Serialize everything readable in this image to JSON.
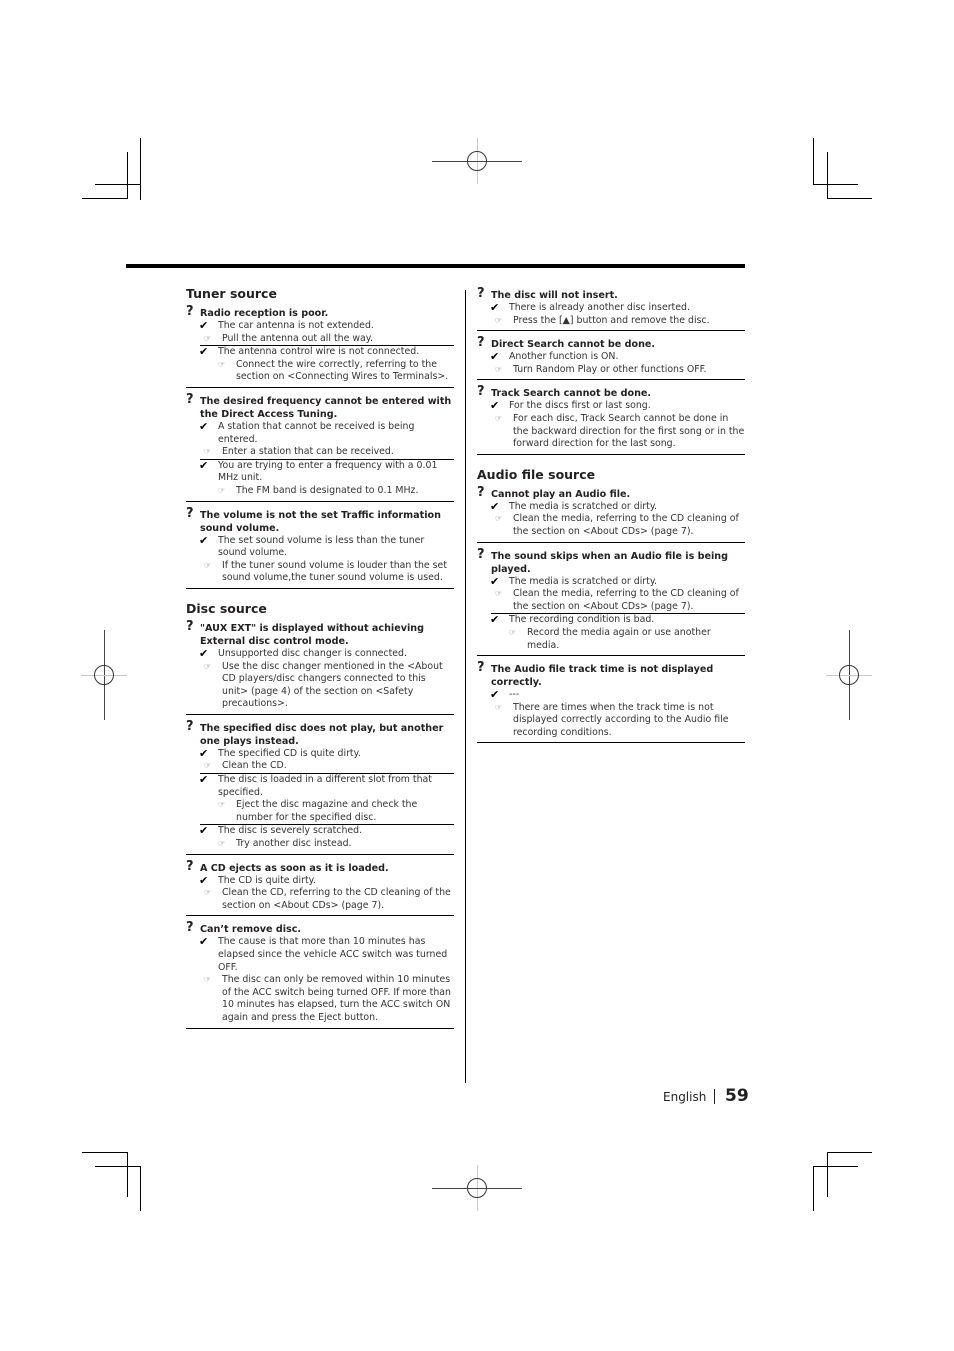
{
  "sections_left": [
    {
      "title": "Tuner source",
      "problems": [
        {
          "question": "Radio reception is poor.",
          "causes": [
            {
              "cause": "The car antenna is not extended.",
              "fix": "Pull the antenna out all the way."
            },
            {
              "cause": "The antenna control wire is not connected.",
              "fix": "Connect the wire correctly, referring to the section on <Connecting Wires to Terminals>."
            }
          ]
        },
        {
          "question": "The desired frequency cannot be entered with the Direct Access Tuning.",
          "causes": [
            {
              "cause": "A station that cannot be received is being entered.",
              "fix": "Enter a station that can be received."
            },
            {
              "cause": "You are trying to enter a frequency with a 0.01 MHz unit.",
              "fix": "The FM band is designated to 0.1 MHz."
            }
          ]
        },
        {
          "question": "The volume is not the set Traffic information sound volume.",
          "causes": [
            {
              "cause": "The set sound volume is less than the tuner sound volume.",
              "fix": "If the tuner sound volume is louder than the set sound volume,the tuner sound volume is used."
            }
          ]
        }
      ]
    },
    {
      "title": "Disc source",
      "problems": [
        {
          "question": "\"AUX EXT\" is displayed without achieving External disc control mode.",
          "causes": [
            {
              "cause": "Unsupported disc changer is connected.",
              "fix": "Use the disc changer mentioned in the <About CD players/disc changers connected to this unit> (page 4) of the section on <Safety precautions>."
            }
          ]
        },
        {
          "question": "The specified disc does not play, but another one plays instead.",
          "causes": [
            {
              "cause": "The specified CD is quite dirty.",
              "fix": "Clean the CD."
            },
            {
              "cause": "The disc is loaded in a different slot from that specified.",
              "fix": "Eject the disc magazine and check the number for the specified disc."
            },
            {
              "cause": "The disc is severely scratched.",
              "fix": "Try another disc instead."
            }
          ]
        },
        {
          "question": "A CD ejects as soon as it is loaded.",
          "causes": [
            {
              "cause": "The CD is quite dirty.",
              "fix": "Clean the CD, referring to the CD cleaning of the section on <About CDs> (page 7)."
            }
          ]
        },
        {
          "question": "Can’t remove disc.",
          "causes": [
            {
              "cause": "The cause is that more than 10 minutes has elapsed since the vehicle ACC switch was turned OFF.",
              "fix": "The disc can only be removed within 10 minutes of the ACC switch being turned OFF. If more than 10 minutes has elapsed, turn the ACC switch ON again and press the Eject button."
            }
          ]
        }
      ]
    }
  ],
  "sections_right": [
    {
      "title": "",
      "problems": [
        {
          "question": "The disc will not insert.",
          "causes": [
            {
              "cause": "There is already another disc inserted.",
              "fix": "Press the [▲] button and remove the disc."
            }
          ]
        },
        {
          "question": "Direct Search cannot be done.",
          "causes": [
            {
              "cause": "Another function is ON.",
              "fix": "Turn Random Play or other functions OFF."
            }
          ]
        },
        {
          "question": "Track Search cannot be done.",
          "causes": [
            {
              "cause": "For the discs first or last song.",
              "fix": "For each disc, Track Search cannot be done in the backward direction for the first song or in the forward direction for the last song."
            }
          ]
        }
      ]
    },
    {
      "title": "Audio file source",
      "problems": [
        {
          "question": "Cannot play an Audio file.",
          "causes": [
            {
              "cause": "The media is scratched or dirty.",
              "fix": "Clean the media, referring to the CD cleaning of the section on <About CDs> (page 7)."
            }
          ]
        },
        {
          "question": "The sound skips when an Audio file is being played.",
          "causes": [
            {
              "cause": "The media is scratched or dirty.",
              "fix": "Clean the media, referring to the CD cleaning of the section on <About CDs> (page 7)."
            },
            {
              "cause": "The recording condition is bad.",
              "fix": "Record the media again or use another media."
            }
          ]
        },
        {
          "question": "The Audio file track time is not displayed correctly.",
          "causes": [
            {
              "cause": "---",
              "fix": "There are times when the track time is not displayed correctly according to the Audio file recording conditions."
            }
          ]
        }
      ]
    }
  ],
  "icons": {
    "question": "?",
    "cause": "✔",
    "fix": "☞"
  },
  "footer": {
    "language": "English",
    "page_number": "59"
  }
}
